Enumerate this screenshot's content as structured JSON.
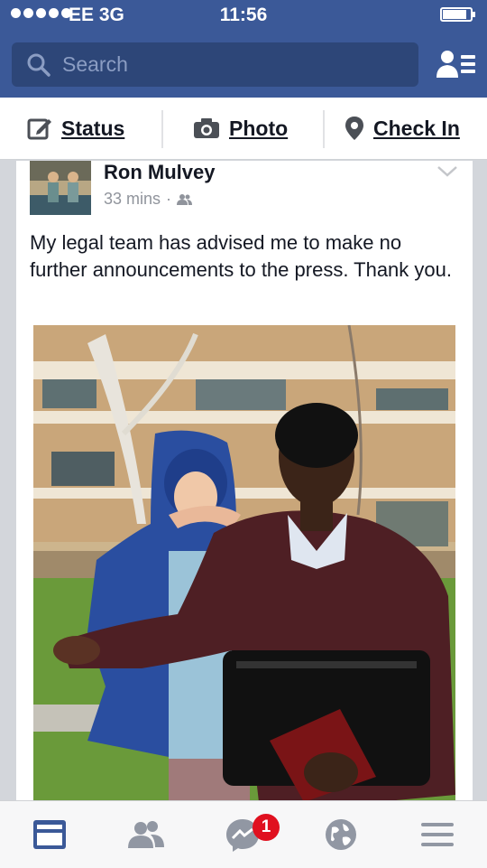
{
  "status_bar": {
    "carrier": "EE  3G",
    "time": "11:56"
  },
  "search": {
    "placeholder": "Search"
  },
  "composer": {
    "status_label": "Status",
    "photo_label": "Photo",
    "checkin_label": "Check In"
  },
  "post": {
    "author": "Ron Mulvey",
    "time": "33 mins",
    "separator": "·",
    "audience_icon": "friends-icon",
    "text": "My legal team has advised me to make no further announcements to the press. Thank you."
  },
  "tabbar": {
    "items": [
      "news-feed",
      "friend-requests",
      "messages",
      "notifications",
      "more"
    ],
    "messages_badge": "1"
  },
  "colors": {
    "brand": "#3b5998",
    "search_bg": "#2d4678",
    "badge": "#e0101f"
  }
}
